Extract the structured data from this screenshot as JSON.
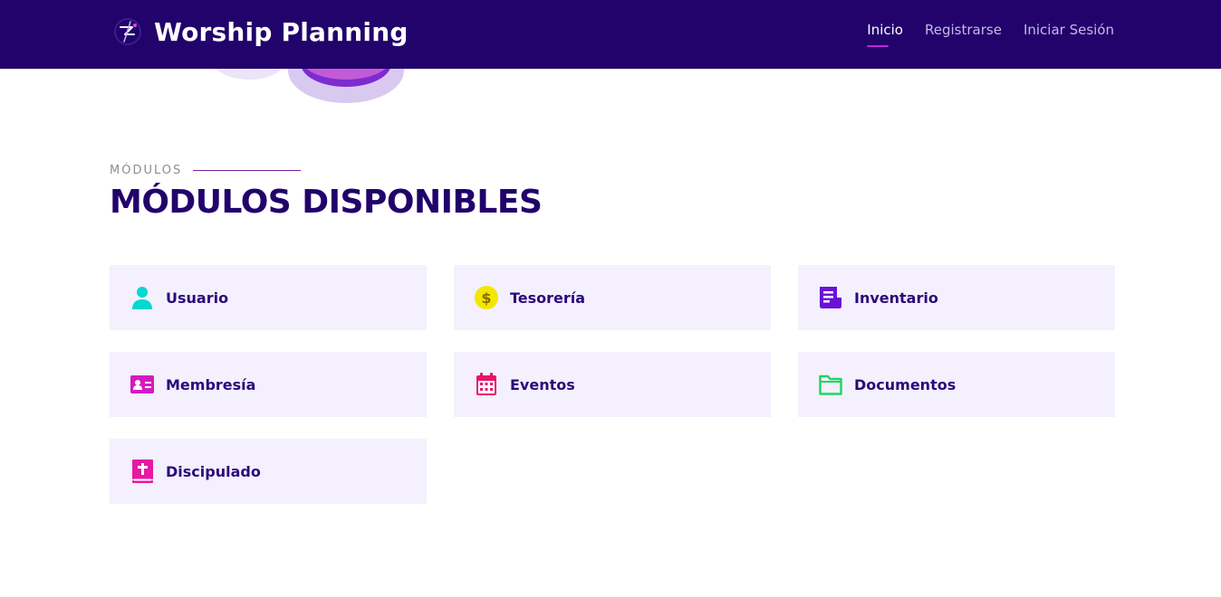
{
  "app": {
    "brand_name": "Worship Planning",
    "logo_icon": "brand-logo-icon"
  },
  "nav": {
    "links": [
      {
        "label": "Inicio",
        "active": true
      },
      {
        "label": "Registrarse",
        "active": false
      },
      {
        "label": "Iniciar Sesión",
        "active": false
      }
    ]
  },
  "section": {
    "eyebrow": "MÓDULOS",
    "title": "MÓDULOS DISPONIBLES"
  },
  "modules": [
    {
      "label": "Usuario",
      "icon": "user-icon",
      "color": "#00d9d0"
    },
    {
      "label": "Tesorería",
      "icon": "dollar-coin-icon",
      "color": "#f5e600"
    },
    {
      "label": "Inventario",
      "icon": "receipt-icon",
      "color": "#6a11d8"
    },
    {
      "label": "Membresía",
      "icon": "id-card-icon",
      "color": "#d419c4"
    },
    {
      "label": "Eventos",
      "icon": "calendar-icon",
      "color": "#e9156b"
    },
    {
      "label": "Documentos",
      "icon": "folder-icon",
      "color": "#1ed760"
    },
    {
      "label": "Discipulado",
      "icon": "bible-icon",
      "color": "#e619a3"
    }
  ],
  "colors": {
    "navbar": "#21036b",
    "title": "#21036b",
    "card_bg": "#f4f0fd",
    "active_underline": "#c026d3"
  }
}
